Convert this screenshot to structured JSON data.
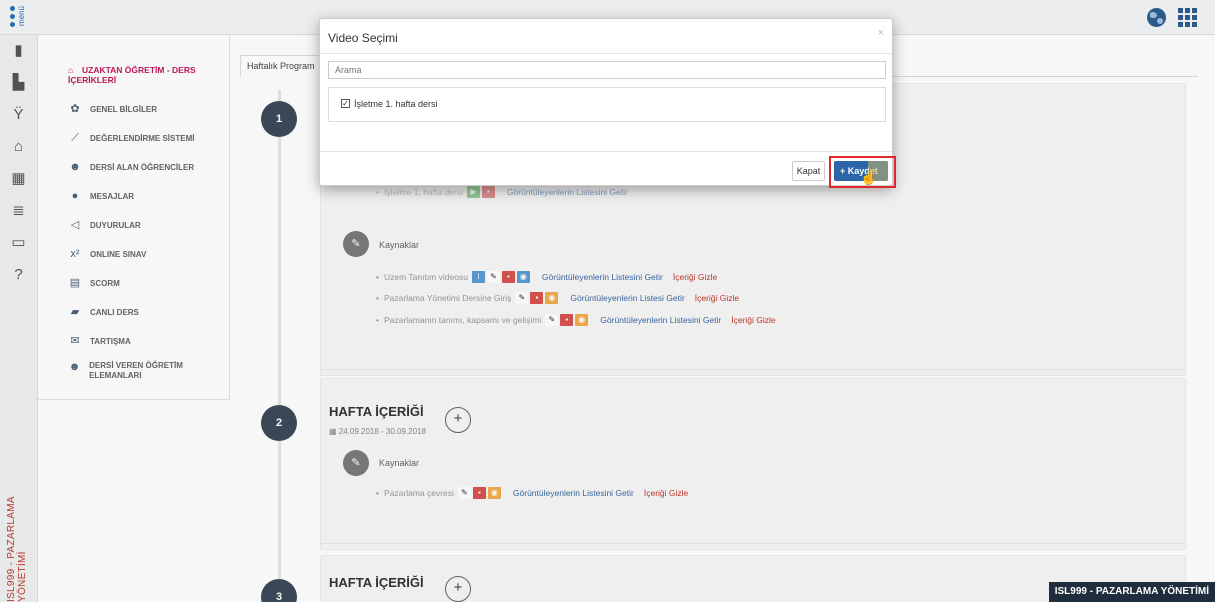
{
  "topbar": {
    "menu_label": "menü"
  },
  "rail": {
    "vertical_label": "ISL999 - PAZARLAMA YÖNETİMİ"
  },
  "course_menu": {
    "title": "UZAKTAN ÖĞRETİM - DERS İÇERİKLERİ",
    "items": [
      {
        "label": "GENEL BİLGİLER",
        "icon": "gauge-icon"
      },
      {
        "label": "DEĞERLENDİRME SİSTEMİ",
        "icon": "chart-icon"
      },
      {
        "label": "DERSİ ALAN ÖĞRENCİLER",
        "icon": "users-icon"
      },
      {
        "label": "MESAJLAR",
        "icon": "chat-icon"
      },
      {
        "label": "DUYURULAR",
        "icon": "megaphone-icon"
      },
      {
        "label": "ONLINE SINAV",
        "icon": "formula-icon"
      },
      {
        "label": "SCORM",
        "icon": "file-icon"
      },
      {
        "label": "CANLI DERS",
        "icon": "book-icon"
      },
      {
        "label": "TARTIŞMA",
        "icon": "envelope-icon"
      },
      {
        "label": "DERSİ VEREN ÖĞRETİM ELEMANLARI",
        "icon": "group-icon"
      }
    ]
  },
  "main": {
    "tab_label": "Haftalık Program",
    "steps": [
      "1",
      "2",
      "3"
    ],
    "week1": {
      "faded_row": "İşletme 1. hafta dersi",
      "faded_link": "Görüntüleyenlerin Listesini Getir",
      "resources_title": "Kaynaklar",
      "rows": [
        {
          "name": "Uzem Tanıtım videosu",
          "link": "Görüntüleyenlerin Listesini Getir",
          "hide": "İçeriği Gizle"
        },
        {
          "name": "Pazarlama Yönetimi Dersine Giriş",
          "link": "Görüntüleyenlerin Listesi Getir",
          "hide": "İçeriği Gizle"
        },
        {
          "name": "Pazarlamanın tanımı, kapsamı ve gelişimi",
          "link": "Görüntüleyenlerin Listesini Getir",
          "hide": "İçeriği Gizle"
        }
      ]
    },
    "week2": {
      "title": "HAFTA İÇERİĞİ",
      "date": "24.09.2018 - 30.09.2018",
      "resources_title": "Kaynaklar",
      "rows": [
        {
          "name": "Pazarlama çevresi",
          "link": "Görüntüleyenlerin Listesini Getir",
          "hide": "İçeriği Gizle"
        }
      ]
    },
    "week3": {
      "title": "HAFTA İÇERİĞİ"
    }
  },
  "modal": {
    "title": "Video Seçimi",
    "close": "×",
    "search_placeholder": "Arama",
    "list_item": "İşletme 1. hafta dersi",
    "close_button": "Kapat",
    "save_button": "+ Kaydet"
  },
  "course_badge": "ISL999 - PAZARLAMA YÖNETİMİ"
}
